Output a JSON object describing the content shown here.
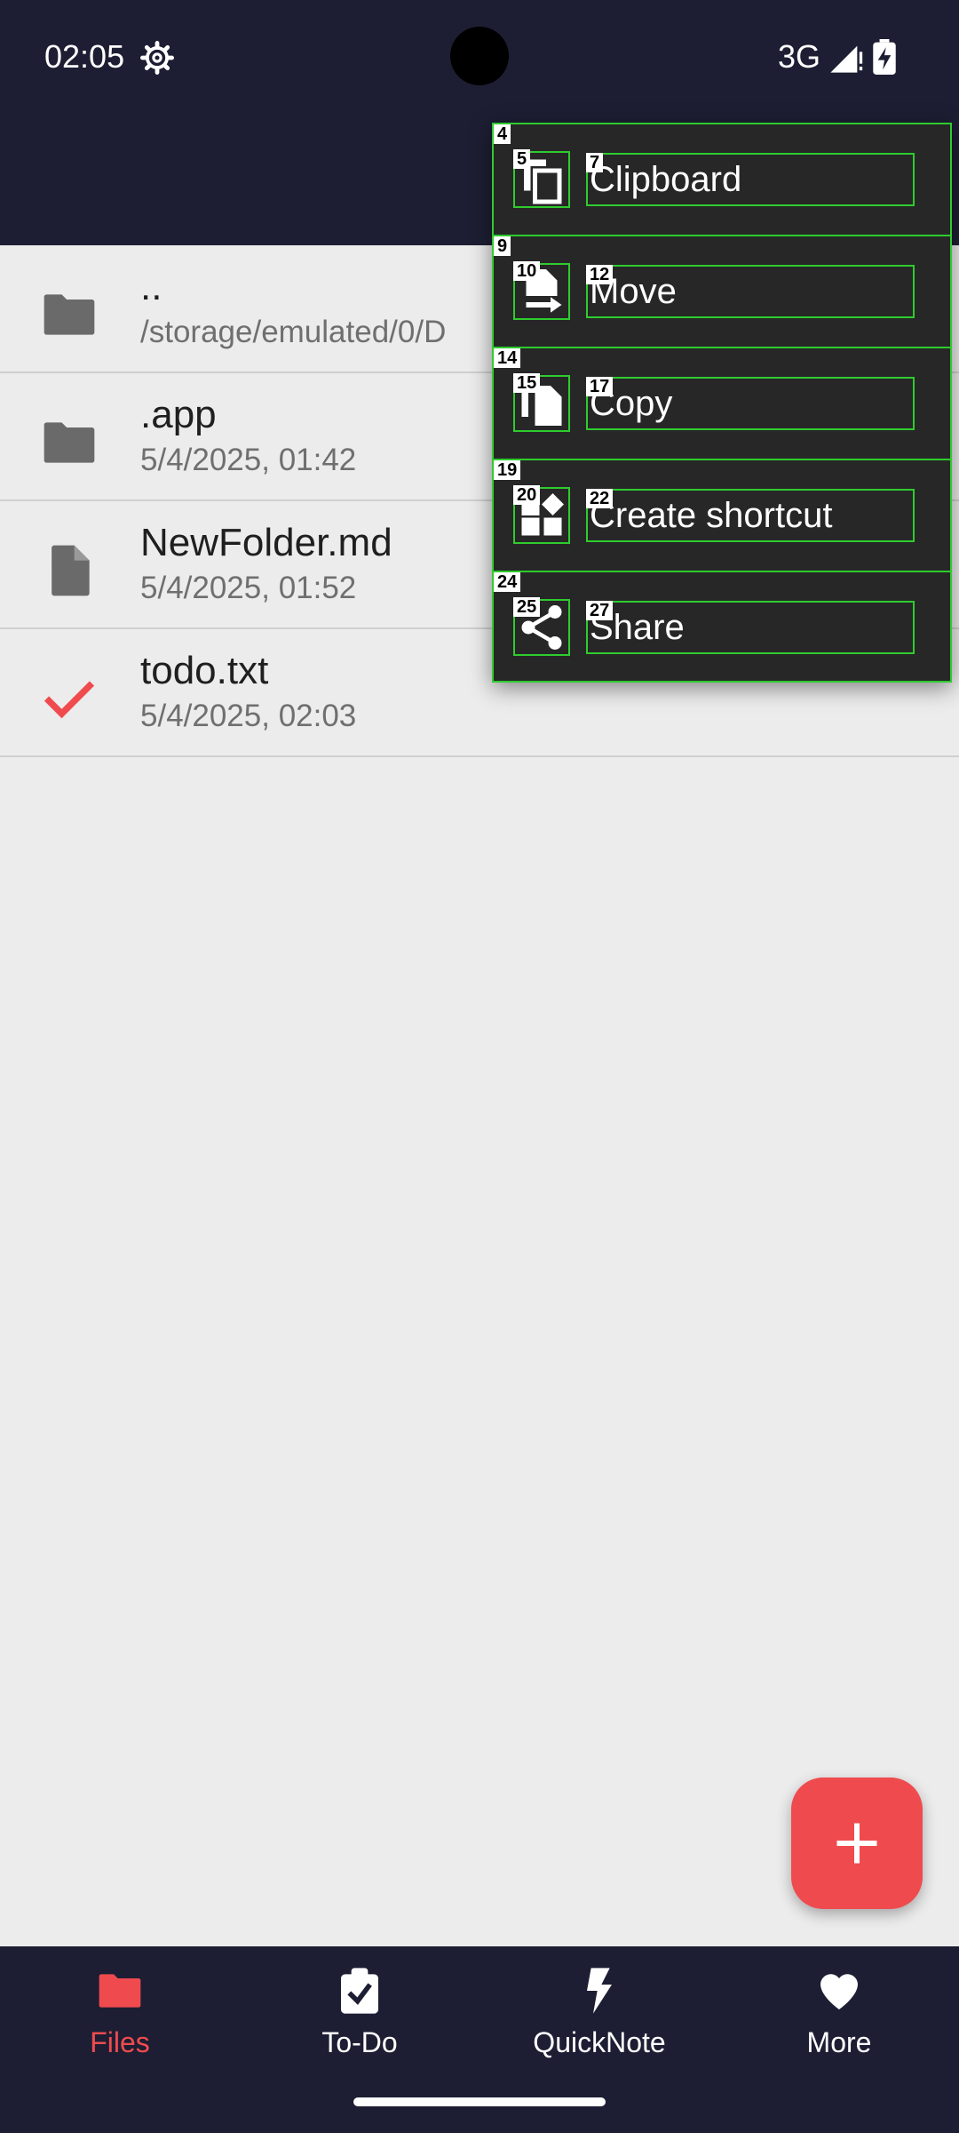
{
  "status_bar": {
    "time": "02:05",
    "network": "3G",
    "icons": [
      "gear-icon",
      "signal-icon",
      "battery-charging-icon"
    ]
  },
  "files": [
    {
      "name": "..",
      "subtitle": "/storage/emulated/0/D",
      "icon": "folder-icon"
    },
    {
      "name": ".app",
      "subtitle": "5/4/2025, 01:42",
      "icon": "folder-icon"
    },
    {
      "name": "NewFolder.md",
      "subtitle": "5/4/2025, 01:52",
      "icon": "file-icon"
    },
    {
      "name": "todo.txt",
      "subtitle": "5/4/2025, 02:03",
      "icon": "check-icon"
    }
  ],
  "menu": {
    "items": [
      {
        "tag": "4",
        "icon_tag": "5",
        "label_tag": "7",
        "label": "Clipboard",
        "icon": "clipboard-icon"
      },
      {
        "tag": "9",
        "icon_tag": "10",
        "label_tag": "12",
        "label": "Move",
        "icon": "move-file-icon"
      },
      {
        "tag": "14",
        "icon_tag": "15",
        "label_tag": "17",
        "label": "Copy",
        "icon": "copy-file-icon"
      },
      {
        "tag": "19",
        "icon_tag": "20",
        "label_tag": "22",
        "label": "Create shortcut",
        "icon": "shortcut-icon"
      },
      {
        "tag": "24",
        "icon_tag": "25",
        "label_tag": "27",
        "label": "Share",
        "icon": "share-icon"
      }
    ]
  },
  "bottom_nav": {
    "items": [
      {
        "label": "Files",
        "icon": "folder-icon",
        "active": true
      },
      {
        "label": "To-Do",
        "icon": "clipboard-check-icon",
        "active": false
      },
      {
        "label": "QuickNote",
        "icon": "bolt-icon",
        "active": false
      },
      {
        "label": "More",
        "icon": "heart-icon",
        "active": false
      }
    ]
  },
  "colors": {
    "dark_bar": "#1d1e33",
    "accent": "#ef4b4f",
    "background": "#ececec",
    "menu_background": "#272727",
    "annotation_outline": "#2ecc2e"
  }
}
